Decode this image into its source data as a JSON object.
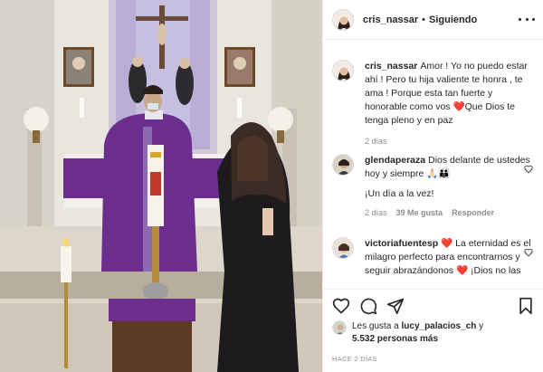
{
  "post": {
    "username": "cris_nassar",
    "separator": "•",
    "follow_state": "Siguiendo"
  },
  "caption": {
    "username": "cris_nassar",
    "text": "Amor ! Yo no puedo estar ahí ! Pero tu hija valiente te honra , te ama ! Porque esta tan fuerte y honorable como vos ",
    "heart": "❤️",
    "text_end": "Que Dios te tenga pleno y en paz",
    "age": "2 días"
  },
  "comments": [
    {
      "username": "glendaperaza",
      "text": "Dios delante de ustedes hoy y siempre 🙏🏻👪",
      "extra": "¡Un día a la vez!",
      "age": "2 días",
      "likes": "39 Me gusta",
      "reply_label": "Responder"
    },
    {
      "username": "victoriafuentesp",
      "heart": "❤️",
      "text": "La eternidad es el milagro perfecto para encontrarnos y seguir abrazándonos ",
      "heart2": "❤️",
      "text_end": "¡Dios no las"
    }
  ],
  "likes": {
    "prefix": "Les gusta a",
    "user": "lucy_palacios_ch",
    "joiner": "y",
    "others": "5.532 personas más"
  },
  "timestamp": "HACE 2 DÍAS",
  "colors": {
    "accent_heart": "#ed4956",
    "text": "#262626",
    "muted": "#8e8e8e",
    "vestment": "#6b2d8e"
  },
  "icons": [
    "more-icon",
    "heart-icon",
    "comment-icon",
    "share-icon",
    "bookmark-icon"
  ]
}
